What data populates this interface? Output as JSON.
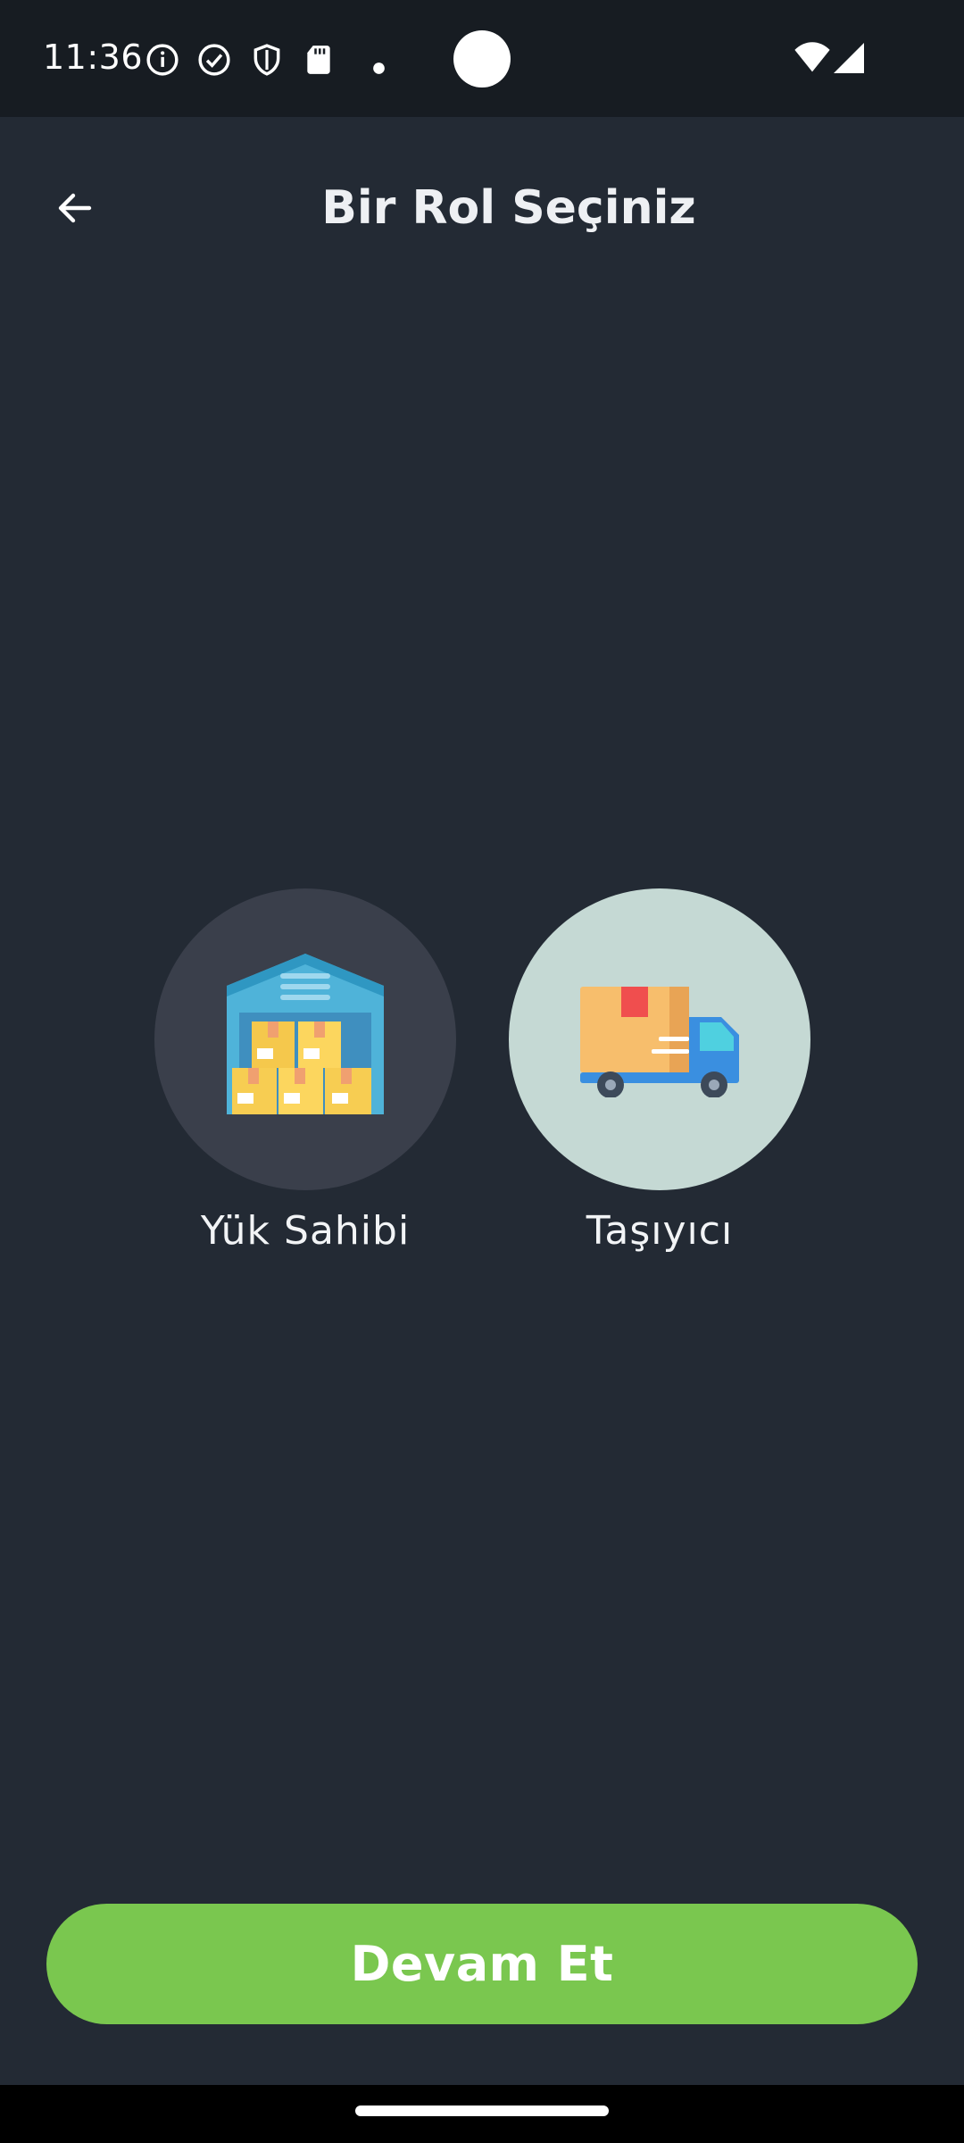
{
  "status_bar": {
    "time": "11:36",
    "left_icons": [
      "info-icon",
      "check-circle-icon",
      "shield-icon",
      "sd-card-icon",
      "dot-icon"
    ],
    "right_icons": [
      "wifi-icon",
      "cellular-signal-icon"
    ]
  },
  "app_bar": {
    "back_icon": "arrow-left-icon",
    "title": "Bir Rol Seçiniz"
  },
  "roles": [
    {
      "label": "Yük Sahibi",
      "icon": "warehouse-icon",
      "selected": false,
      "circle_color": "#3a3f4b"
    },
    {
      "label": "Taşıyıcı",
      "icon": "delivery-truck-icon",
      "selected": true,
      "circle_color": "#c5d9d4"
    }
  ],
  "continue_button": {
    "label": "Devam Et",
    "color": "#7ac74f"
  },
  "colors": {
    "background": "#232a34",
    "status_bar": "#171c22"
  }
}
